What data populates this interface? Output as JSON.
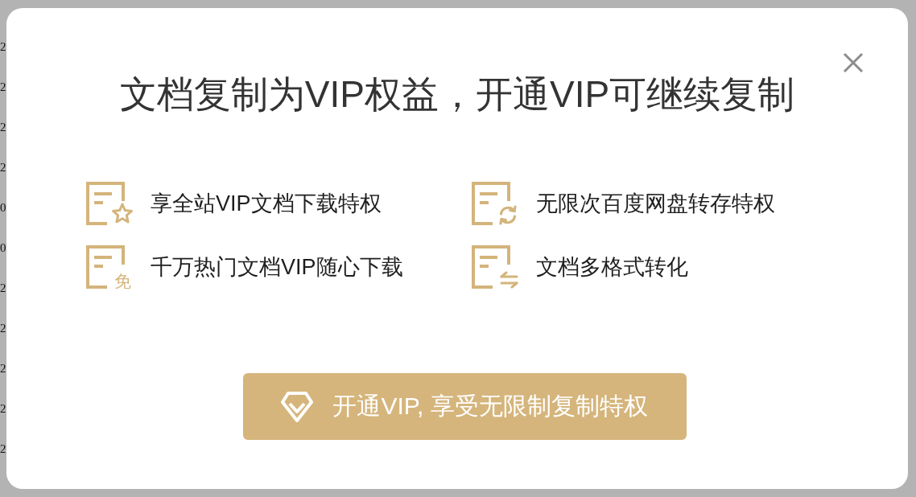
{
  "backdrop": {
    "line_starts": [
      "2",
      "2",
      "2",
      "2",
      "0",
      "0",
      "2",
      "2",
      "2",
      "2",
      "2"
    ]
  },
  "dialog": {
    "title": "文档复制为VIP权益，开通VIP可继续复制",
    "benefits": [
      {
        "kind": "star",
        "label": "享全站VIP文档下载特权"
      },
      {
        "kind": "refresh",
        "label": "无限次百度网盘转存特权"
      },
      {
        "kind": "badge",
        "badge": "免",
        "label": "千万热门文档VIP随心下载"
      },
      {
        "kind": "swap",
        "label": "文档多格式转化"
      }
    ],
    "button": {
      "label": "开通VIP, 享受无限制复制特权"
    }
  }
}
